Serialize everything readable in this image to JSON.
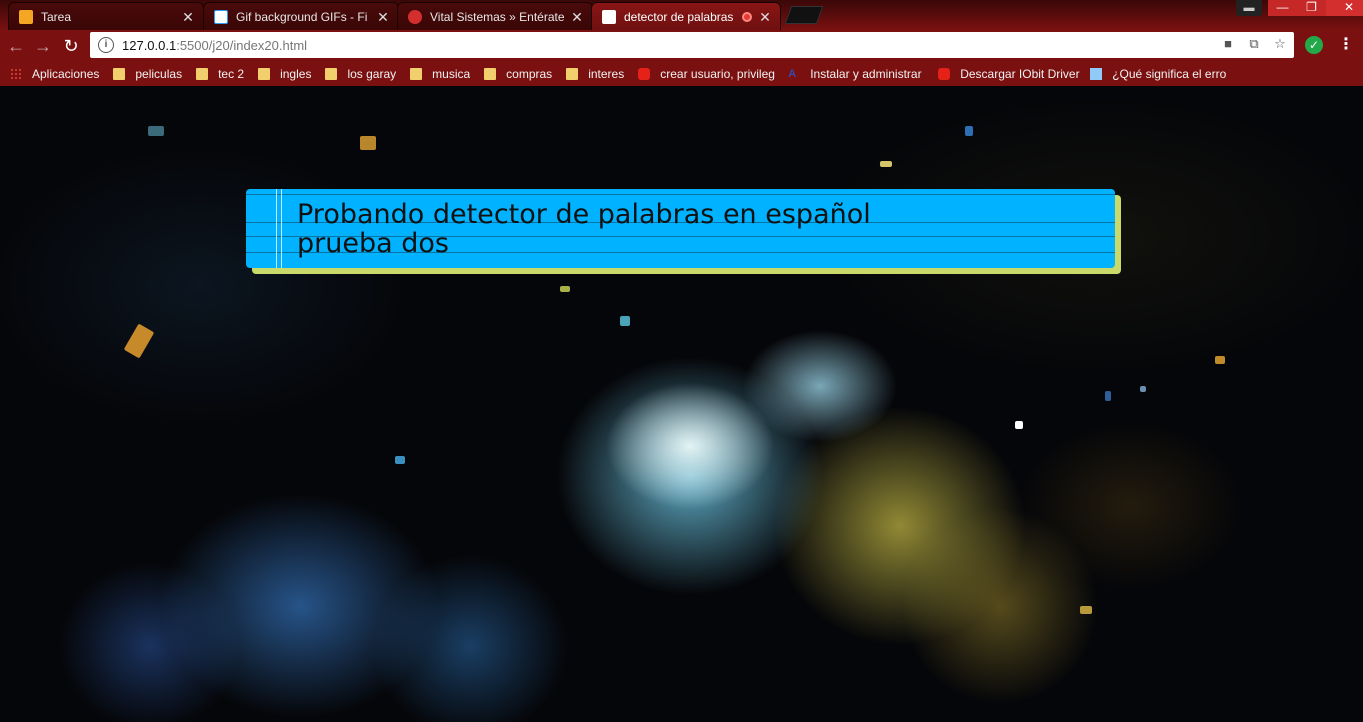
{
  "browser": {
    "tabs": [
      {
        "title": "Tarea",
        "favicon": "tarea-icon",
        "active": false
      },
      {
        "title": "Gif background GIFs - Fi",
        "favicon": "document-icon",
        "active": false
      },
      {
        "title": "Vital Sistemas » Entérate",
        "favicon": "vital-sistemas-icon",
        "active": false
      },
      {
        "title": "detector de palabras",
        "favicon": "page-icon",
        "active": true
      }
    ],
    "url_host": "127.0.0.1",
    "url_rest": ":5500/j20/index20.html",
    "bookmarks": [
      {
        "label": "Aplicaciones",
        "icon": "apps-grid-icon"
      },
      {
        "label": "peliculas",
        "icon": "folder-icon"
      },
      {
        "label": "tec 2",
        "icon": "folder-icon"
      },
      {
        "label": "ingles",
        "icon": "folder-icon"
      },
      {
        "label": "los garay",
        "icon": "folder-icon"
      },
      {
        "label": "musica",
        "icon": "folder-icon"
      },
      {
        "label": "compras",
        "icon": "folder-icon"
      },
      {
        "label": "interes",
        "icon": "folder-icon"
      },
      {
        "label": "crear usuario, privileg",
        "icon": "youtube-icon"
      },
      {
        "label": "Instalar y administrar",
        "icon": "a-logo-icon"
      },
      {
        "label": "Descargar IObit Driver",
        "icon": "youtube-icon"
      },
      {
        "label": "¿Qué significa el error",
        "icon": "r-logo-icon"
      }
    ]
  },
  "page": {
    "line1": "Probando detector de palabras en español",
    "line2": "prueba dos"
  },
  "colors": {
    "chrome_red": "#7a1010",
    "card_blue": "#00b2ff",
    "card_shadow": "#c9d96a"
  }
}
